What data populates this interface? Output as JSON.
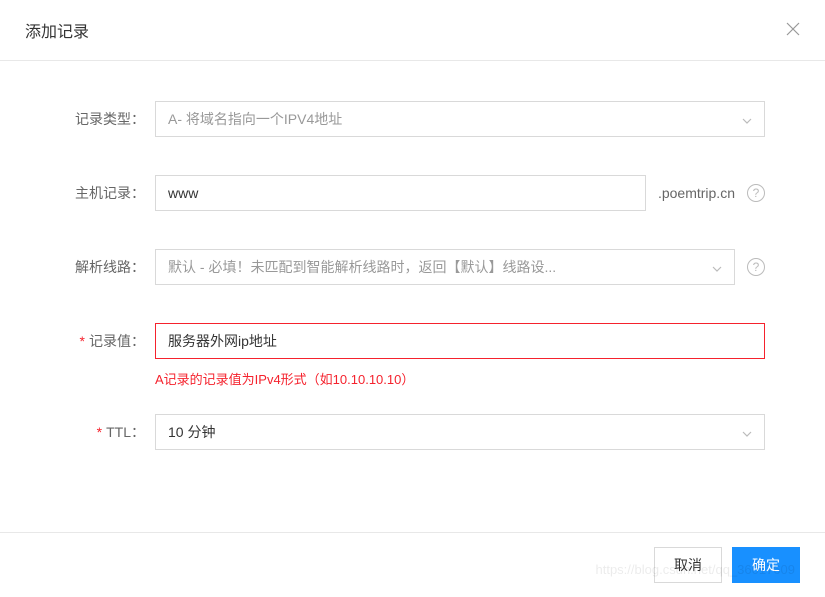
{
  "modal": {
    "title": "添加记录"
  },
  "form": {
    "recordType": {
      "label": "记录类型：",
      "value": "A- 将域名指向一个IPV4地址"
    },
    "hostRecord": {
      "label": "主机记录：",
      "value": "www",
      "suffix": ".poemtrip.cn"
    },
    "line": {
      "label": "解析线路：",
      "value": "默认 - 必填！未匹配到智能解析线路时，返回【默认】线路设..."
    },
    "recordValue": {
      "label": "记录值：",
      "value": "服务器外网ip地址",
      "error": "A记录的记录值为IPv4形式（如10.10.10.10）"
    },
    "ttl": {
      "label": "TTL：",
      "value": "10 分钟"
    }
  },
  "footer": {
    "cancel": "取消",
    "confirm": "确定"
  },
  "watermark": "https://blog.csdn.net/qq_36017609"
}
